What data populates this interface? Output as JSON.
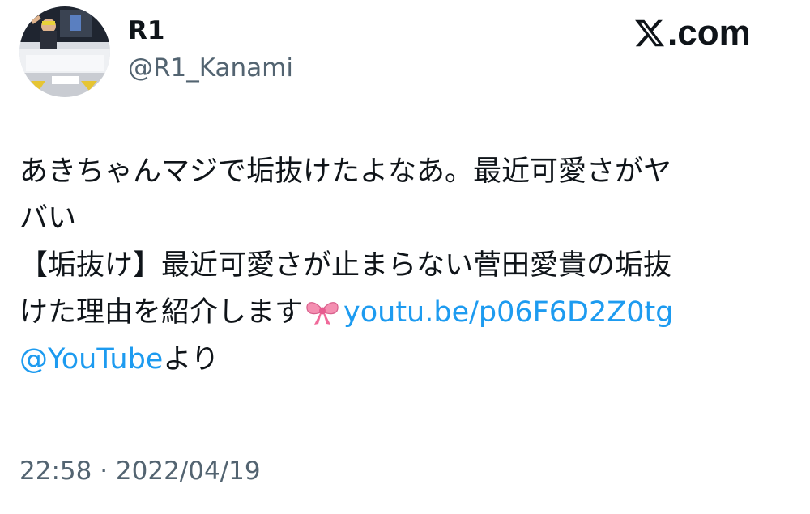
{
  "author": {
    "display_name": "R1",
    "handle": "@R1_Kanami"
  },
  "brand": {
    "logo_icon": "x-logo-icon",
    "domain_suffix": ".com"
  },
  "tweet": {
    "line1": "あきちゃんマジで垢抜けたよなあ。最近可愛さがヤ",
    "line2": "バい",
    "line3": "【垢抜け】最近可愛さが止まらない菅田愛貴の垢抜",
    "line4_text": "けた理由を紹介します",
    "line4_emoji": "ribbon-icon",
    "link_url": "youtu.be/p06F6D2Z0tg",
    "mention": "@YouTube",
    "mention_suffix": "より"
  },
  "meta": {
    "time": "22:58",
    "separator": "·",
    "date": "2022/04/19"
  },
  "colors": {
    "link": "#1d9bf0",
    "secondary_text": "#536471",
    "primary_text": "#0f1419",
    "ribbon": "#f48fb1"
  }
}
